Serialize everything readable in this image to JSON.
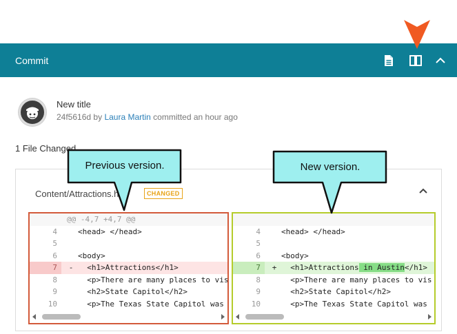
{
  "header": {
    "title": "Commit"
  },
  "commit": {
    "title": "New title",
    "hash": "24f5616d",
    "by": "by",
    "author": "Laura Martin",
    "action": "committed an hour ago"
  },
  "files_changed": "1 File Changed",
  "file": {
    "path": "Content/Attractions.htm",
    "badge": "CHANGED"
  },
  "diff": {
    "left": [
      {
        "ln": "",
        "sign": "",
        "code": "@@ -4,7 +4,7 @@",
        "type": "hunk"
      },
      {
        "ln": "4",
        "sign": "",
        "code": "<head> </head>",
        "type": "ctx"
      },
      {
        "ln": "5",
        "sign": "",
        "code": "",
        "type": "ctx"
      },
      {
        "ln": "6",
        "sign": "",
        "code": "<body>",
        "type": "ctx"
      },
      {
        "ln": "7",
        "sign": "-",
        "code": "  <h1>Attractions</h1>",
        "type": "del"
      },
      {
        "ln": "8",
        "sign": "",
        "code": "  <p>There are many places to vis",
        "type": "ctx"
      },
      {
        "ln": "9",
        "sign": "",
        "code": "  <h2>State Capitol</h2>",
        "type": "ctx"
      },
      {
        "ln": "10",
        "sign": "",
        "code": "  <p>The Texas State Capitol was",
        "type": "ctx"
      }
    ],
    "right": [
      {
        "ln": "",
        "sign": "",
        "code": "",
        "type": "hunk"
      },
      {
        "ln": "4",
        "sign": "",
        "code": "<head> </head>",
        "type": "ctx"
      },
      {
        "ln": "5",
        "sign": "",
        "code": "",
        "type": "ctx"
      },
      {
        "ln": "6",
        "sign": "",
        "code": "<body>",
        "type": "ctx"
      },
      {
        "ln": "7",
        "sign": "+",
        "code_before": "  <h1>Attractions",
        "code_hl": " in Austin",
        "code_after": "</h1>",
        "type": "add"
      },
      {
        "ln": "8",
        "sign": "",
        "code": "  <p>There are many places to vis",
        "type": "ctx"
      },
      {
        "ln": "9",
        "sign": "",
        "code": "  <h2>State Capitol</h2>",
        "type": "ctx"
      },
      {
        "ln": "10",
        "sign": "",
        "code": "  <p>The Texas State Capitol was",
        "type": "ctx"
      }
    ]
  },
  "callouts": {
    "previous": "Previous version.",
    "new": "New version."
  },
  "colors": {
    "header_bg": "#0e7f96",
    "pointer": "#f05a22",
    "callout_fill": "#9eefef",
    "left_border": "#d35a3a",
    "right_border": "#b5cc2a",
    "badge": "#e8a317"
  },
  "icons": {
    "document": "document-icon",
    "split_view": "split-view-icon",
    "collapse": "chevron-up-icon",
    "pointer": "pointer-arrow-icon"
  }
}
